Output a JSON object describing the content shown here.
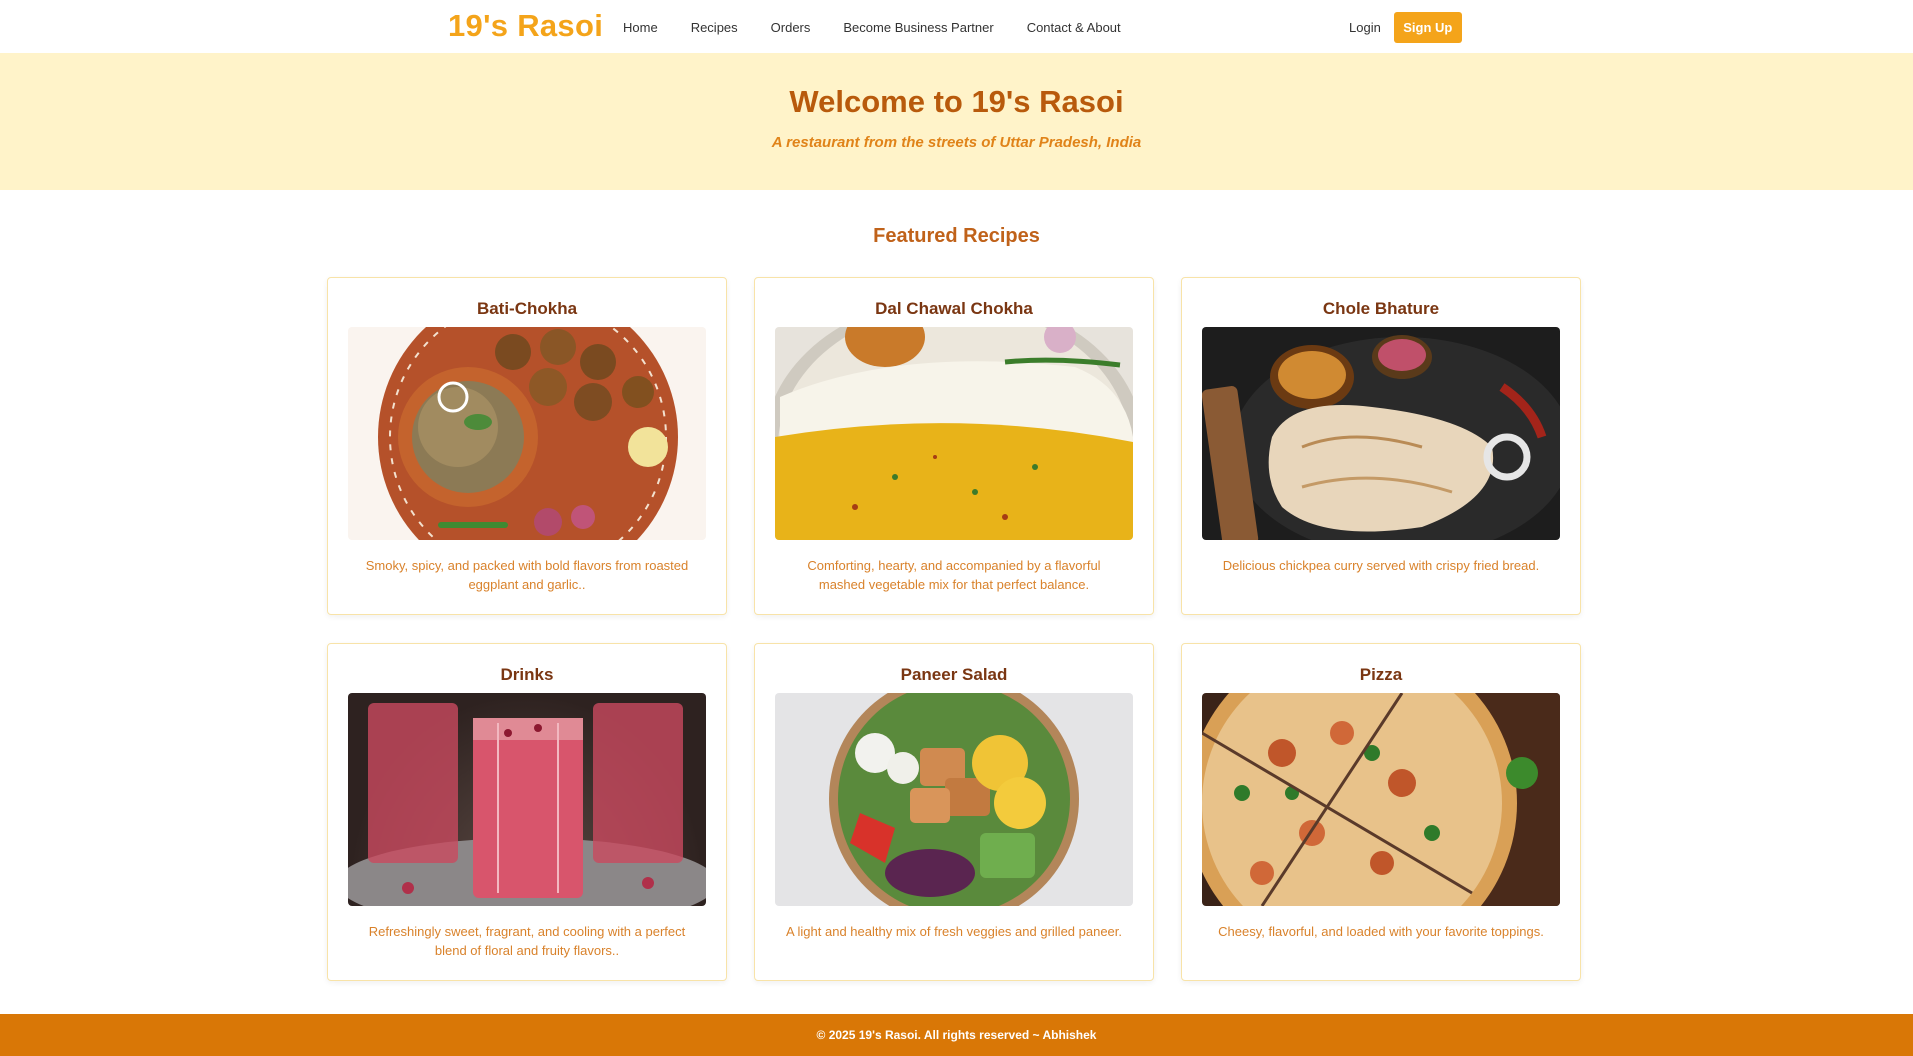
{
  "nav": {
    "brand": "19's Rasoi",
    "links": [
      {
        "label": "Home"
      },
      {
        "label": "Recipes"
      },
      {
        "label": "Orders"
      },
      {
        "label": "Become Business Partner"
      },
      {
        "label": "Contact & About"
      }
    ],
    "login": "Login",
    "signup": "Sign Up"
  },
  "hero": {
    "title": "Welcome to 19's Rasoi",
    "subtitle": "A restaurant from the streets of Uttar Pradesh, India"
  },
  "featured": {
    "heading": "Featured Recipes",
    "cards": [
      {
        "title": "Bati-Chokha",
        "image": "bati-chokha-photo",
        "desc": "Smoky, spicy, and packed with bold flavors from roasted eggplant and garlic.."
      },
      {
        "title": "Dal Chawal Chokha",
        "image": "dal-chawal-photo",
        "desc": "Comforting, hearty, and accompanied by a flavorful mashed vegetable mix for that perfect balance."
      },
      {
        "title": "Chole Bhature",
        "image": "chole-bhature-photo",
        "desc": "Delicious chickpea curry served with crispy fried bread."
      },
      {
        "title": "Drinks",
        "image": "drinks-photo",
        "desc": "Refreshingly sweet, fragrant, and cooling with a perfect blend of floral and fruity flavors.."
      },
      {
        "title": "Paneer Salad",
        "image": "paneer-salad-photo",
        "desc": "A light and healthy mix of fresh veggies and grilled paneer."
      },
      {
        "title": "Pizza",
        "image": "pizza-photo",
        "desc": "Cheesy, flavorful, and loaded with your favorite toppings."
      }
    ]
  },
  "footer": {
    "text": "© 2025 19's Rasoi. All rights reserved ~ Abhishek"
  },
  "colors": {
    "brand": "#f4a41a",
    "hero_bg": "#fff3c9",
    "hero_title": "#b85a0c",
    "footer_bg": "#d97706"
  }
}
